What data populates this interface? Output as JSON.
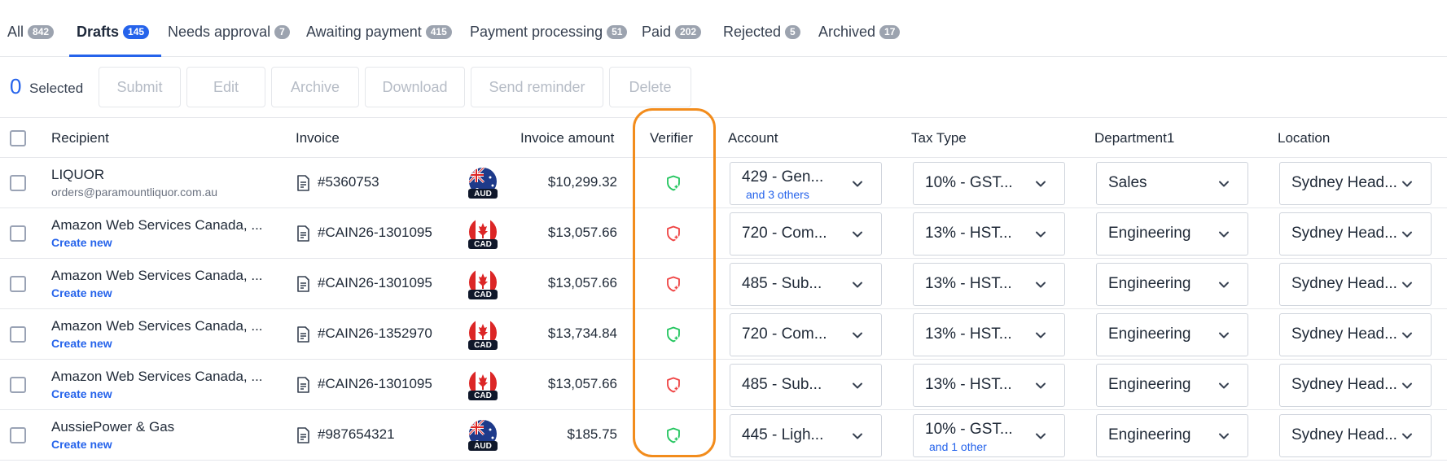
{
  "tabs": [
    {
      "label": "All",
      "count": "842"
    },
    {
      "label": "Drafts",
      "count": "145"
    },
    {
      "label": "Needs approval",
      "count": "7"
    },
    {
      "label": "Awaiting payment",
      "count": "415"
    },
    {
      "label": "Payment processing",
      "count": "51"
    },
    {
      "label": "Paid",
      "count": "202"
    },
    {
      "label": "Rejected",
      "count": "5"
    },
    {
      "label": "Archived",
      "count": "17"
    }
  ],
  "toolbar": {
    "selected_count": "0",
    "selected_label": "Selected",
    "submit": "Submit",
    "edit": "Edit",
    "archive": "Archive",
    "download": "Download",
    "send_reminder": "Send reminder",
    "delete": "Delete"
  },
  "columns": {
    "recipient": "Recipient",
    "invoice": "Invoice",
    "amount": "Invoice amount",
    "verifier": "Verifier",
    "account": "Account",
    "tax_type": "Tax Type",
    "department": "Department1",
    "location": "Location"
  },
  "rows": [
    {
      "recipient": "LIQUOR",
      "sub": "orders@paramountliquor.com.au",
      "invoice": "#5360753",
      "currency": "AUD",
      "amount": "$10,299.32",
      "verified": "verified",
      "account": "429 - Gen...",
      "account_sub": "and 3 others",
      "tax": "10% - GST...",
      "tax_sub": "",
      "department": "Sales",
      "location": "Sydney Head..."
    },
    {
      "recipient": "Amazon Web Services Canada, ...",
      "sub": "Create new",
      "invoice": "#CAIN26-1301095",
      "currency": "CAD",
      "amount": "$13,057.66",
      "verified": "unverified",
      "account": "720 - Com...",
      "account_sub": "",
      "tax": "13% - HST...",
      "tax_sub": "",
      "department": "Engineering",
      "location": "Sydney Head..."
    },
    {
      "recipient": "Amazon Web Services Canada, ...",
      "sub": "Create new",
      "invoice": "#CAIN26-1301095",
      "currency": "CAD",
      "amount": "$13,057.66",
      "verified": "unverified",
      "account": "485 - Sub...",
      "account_sub": "",
      "tax": "13% - HST...",
      "tax_sub": "",
      "department": "Engineering",
      "location": "Sydney Head..."
    },
    {
      "recipient": "Amazon Web Services Canada, ...",
      "sub": "Create new",
      "invoice": "#CAIN26-1352970",
      "currency": "CAD",
      "amount": "$13,734.84",
      "verified": "verified",
      "account": "720 - Com...",
      "account_sub": "",
      "tax": "13% - HST...",
      "tax_sub": "",
      "department": "Engineering",
      "location": "Sydney Head..."
    },
    {
      "recipient": "Amazon Web Services Canada, ...",
      "sub": "Create new",
      "invoice": "#CAIN26-1301095",
      "currency": "CAD",
      "amount": "$13,057.66",
      "verified": "unverified",
      "account": "485 - Sub...",
      "account_sub": "",
      "tax": "13% - HST...",
      "tax_sub": "",
      "department": "Engineering",
      "location": "Sydney Head..."
    },
    {
      "recipient": "AussiePower & Gas",
      "sub": "Create new",
      "invoice": "#987654321",
      "currency": "AUD",
      "amount": "$185.75",
      "verified": "verified",
      "account": "445 - Ligh...",
      "account_sub": "",
      "tax": "10% - GST...",
      "tax_sub": "and 1 other",
      "department": "Engineering",
      "location": "Sydney Head..."
    }
  ],
  "colors": {
    "accent": "#2563eb",
    "verified": "#22c55e",
    "unverified": "#ef4444",
    "highlight": "#f28c1c"
  },
  "icons": {
    "invoice": "document-icon",
    "verifier": "shield-icon",
    "dropdown": "chevron-down-icon"
  }
}
